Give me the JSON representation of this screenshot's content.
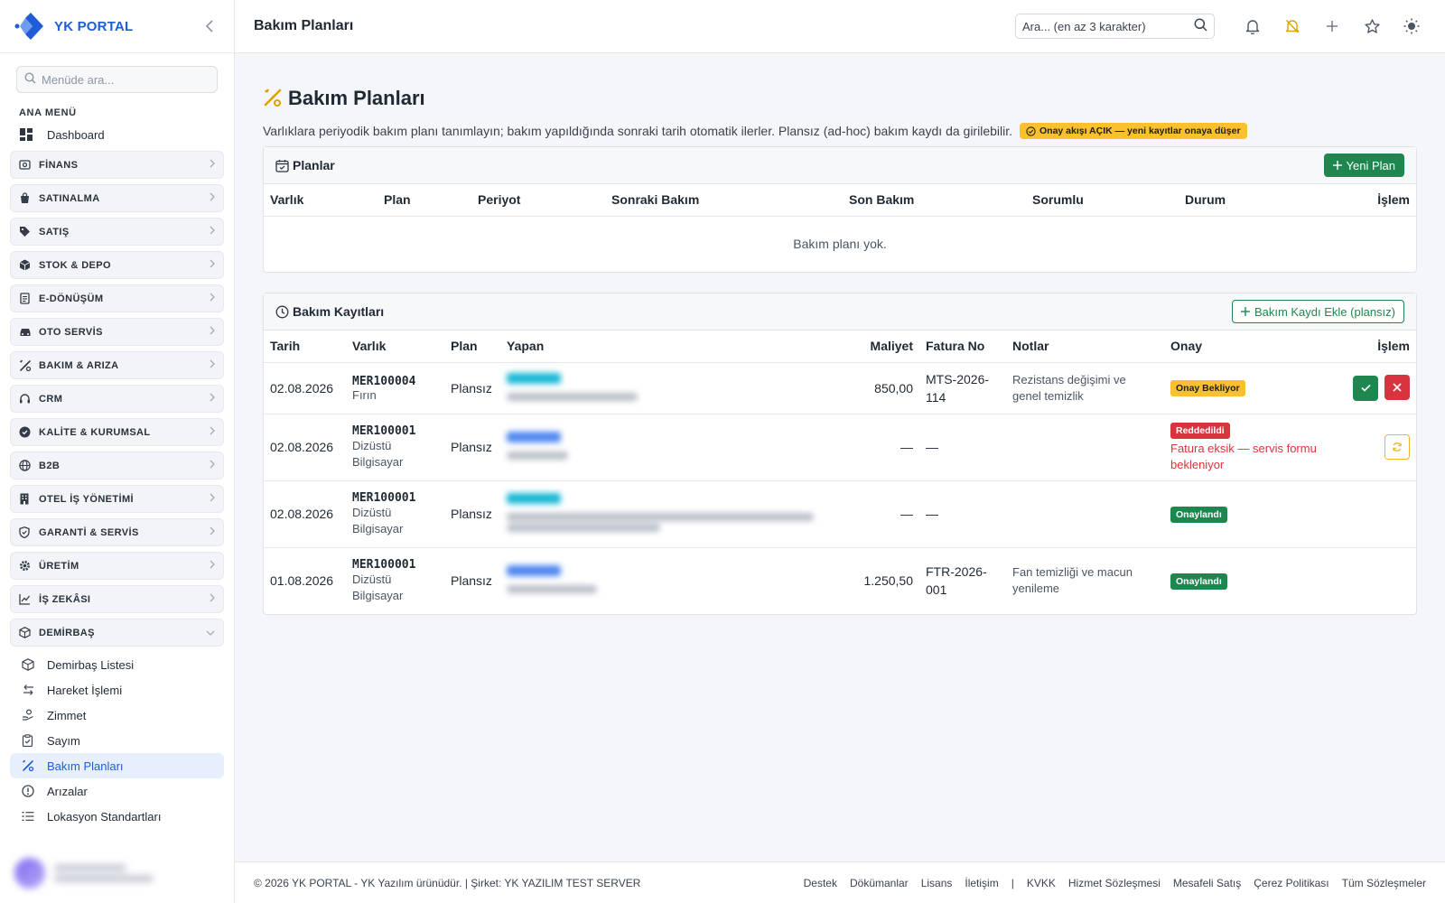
{
  "brand": {
    "name": "YK PORTAL",
    "accent": "#1e5dd6"
  },
  "sidebar": {
    "search_placeholder": "Menüde ara...",
    "heading": "ANA MENÜ",
    "dashboard": "Dashboard",
    "modules": [
      {
        "label": "FİNANS",
        "icon": "finance-icon"
      },
      {
        "label": "SATINALMA",
        "icon": "shopping-icon"
      },
      {
        "label": "SATIŞ",
        "icon": "tag-icon"
      },
      {
        "label": "STOK & DEPO",
        "icon": "box-icon"
      },
      {
        "label": "E-DÖNÜŞÜM",
        "icon": "document-icon"
      },
      {
        "label": "OTO SERVİS",
        "icon": "car-icon"
      },
      {
        "label": "BAKIM & ARIZA",
        "icon": "tools-icon"
      },
      {
        "label": "CRM",
        "icon": "headset-icon"
      },
      {
        "label": "KALİTE & KURUMSAL",
        "icon": "badge-check-icon"
      },
      {
        "label": "B2B",
        "icon": "globe-icon"
      },
      {
        "label": "OTEL İŞ YÖNETİMİ",
        "icon": "building-icon"
      },
      {
        "label": "GARANTİ & SERVİS",
        "icon": "shield-icon"
      },
      {
        "label": "ÜRETİM",
        "icon": "gear-icon"
      },
      {
        "label": "İŞ ZEKÂSI",
        "icon": "chart-icon"
      },
      {
        "label": "DEMİRBAŞ",
        "icon": "asset-box-icon"
      }
    ],
    "demirbas_items": [
      {
        "label": "Demirbaş Listesi",
        "icon": "cube-icon"
      },
      {
        "label": "Hareket İşlemi",
        "icon": "arrows-icon"
      },
      {
        "label": "Zimmet",
        "icon": "user-hand-icon"
      },
      {
        "label": "Sayım",
        "icon": "clipboard-check-icon"
      },
      {
        "label": "Bakım Planları",
        "icon": "tools-icon"
      },
      {
        "label": "Arızalar",
        "icon": "alert-circle-icon"
      },
      {
        "label": "Lokasyon Standartları",
        "icon": "list-icon"
      }
    ]
  },
  "topbar": {
    "title": "Bakım Planları",
    "search_placeholder": "Ara... (en az 3 karakter)"
  },
  "page": {
    "title": "Bakım Planları",
    "description": "Varlıklara periyodik bakım planı tanımlayın; bakım yapıldığında sonraki tarih otomatik ilerler. Plansız (ad-hoc) bakım kaydı da girilebilir.",
    "approval_badge": "Onay akışı AÇIK — yeni kayıtlar onaya düşer"
  },
  "plans": {
    "title": "Planlar",
    "new_button": "Yeni Plan",
    "columns": [
      "Varlık",
      "Plan",
      "Periyot",
      "Sonraki Bakım",
      "Son Bakım",
      "Sorumlu",
      "Durum",
      "İşlem"
    ],
    "empty_text": "Bakım planı yok."
  },
  "records": {
    "title": "Bakım Kayıtları",
    "add_button": "Bakım Kaydı Ekle (plansız)",
    "columns": [
      "Tarih",
      "Varlık",
      "Plan",
      "Yapan",
      "Maliyet",
      "Fatura No",
      "Notlar",
      "Onay",
      "İşlem"
    ],
    "rows": [
      {
        "date": "02.08.2026",
        "asset_code": "MER100004",
        "asset_name": "Fırın",
        "plan": "Plansız",
        "cost": "850,00",
        "invoice": "MTS-2026-114",
        "notes": "Rezistans değişimi ve genel temizlik",
        "status": "Onay Bekliyor",
        "status_note": ""
      },
      {
        "date": "02.08.2026",
        "asset_code": "MER100001",
        "asset_name": "Dizüstü Bilgisayar",
        "plan": "Plansız",
        "cost": "—",
        "invoice": "—",
        "notes": "",
        "status": "Reddedildi",
        "status_note": "Fatura eksik — servis formu bekleniyor"
      },
      {
        "date": "02.08.2026",
        "asset_code": "MER100001",
        "asset_name": "Dizüstü Bilgisayar",
        "plan": "Plansız",
        "cost": "—",
        "invoice": "—",
        "notes": "",
        "status": "Onaylandı",
        "status_note": ""
      },
      {
        "date": "01.08.2026",
        "asset_code": "MER100001",
        "asset_name": "Dizüstü Bilgisayar",
        "plan": "Plansız",
        "cost": "1.250,50",
        "invoice": "FTR-2026-001",
        "notes": "Fan temizliği ve macun yenileme",
        "status": "Onaylandı",
        "status_note": ""
      }
    ]
  },
  "footer": {
    "copyright": "© 2026 YK PORTAL - YK Yazılım ürünüdür. | Şirket: YK YAZILIM TEST SERVER",
    "links": [
      "Destek",
      "Dökümanlar",
      "Lisans",
      "İletişim"
    ],
    "separator": "|",
    "legal_links": [
      "KVKK",
      "Hizmet Sözleşmesi",
      "Mesafeli Satış",
      "Çerez Politikası",
      "Tüm Sözleşmeler"
    ]
  },
  "colors": {
    "success": "#1e874f",
    "danger": "#d7343f",
    "warning": "#fbc02d"
  }
}
